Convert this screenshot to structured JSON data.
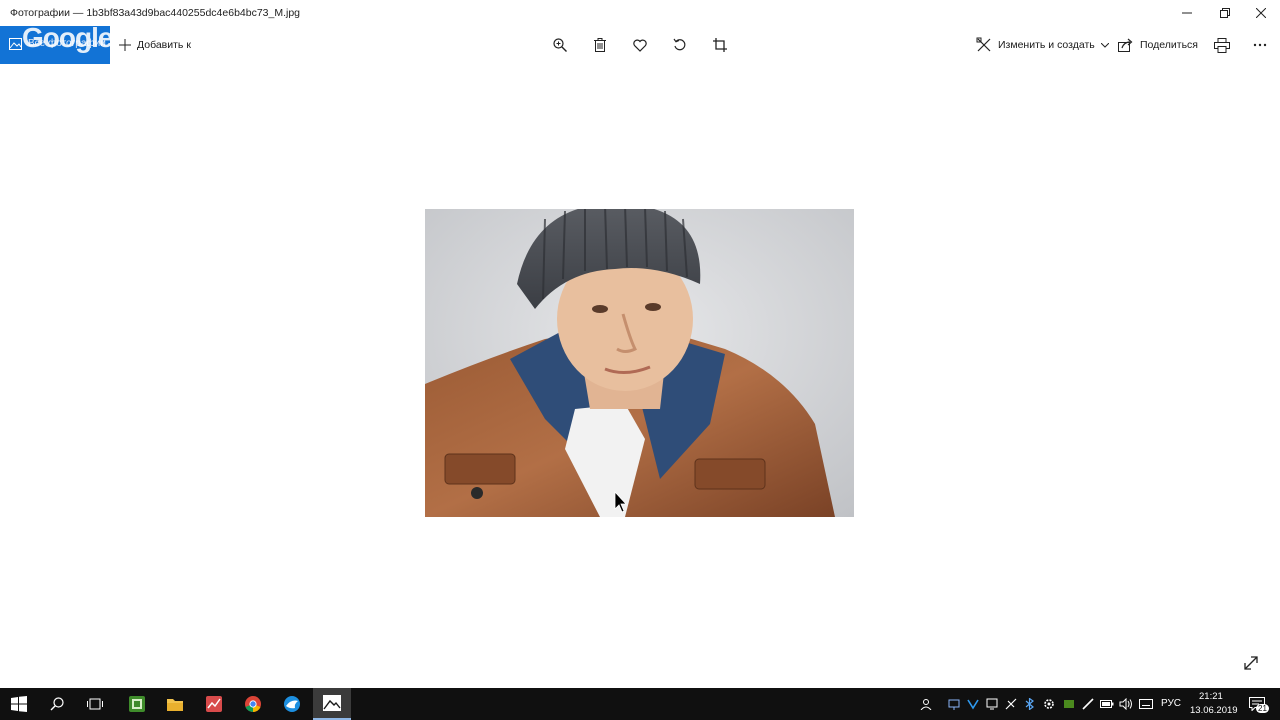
{
  "window": {
    "title": "Фотографии — 1b3bf83a43d9bac440255dc4e6b4bc73_M.jpg"
  },
  "toolbar": {
    "all_photos_label": "Все фотографии",
    "overlay_logo_text": "Google",
    "add_to_label": "Добавить к",
    "edit_create_label": "Изменить и создать",
    "share_label": "Поделиться",
    "icons": [
      "zoom-icon",
      "delete-icon",
      "favorite-icon",
      "rotate-icon",
      "crop-icon",
      "print-icon",
      "more-icon"
    ]
  },
  "taskbar": {
    "apps": [
      "start",
      "search",
      "task-view",
      "camtasia",
      "file-explorer",
      "app-red",
      "chrome",
      "mail",
      "photos"
    ],
    "language": "РУС",
    "time": "21:21",
    "date": "13.06.2019",
    "notification_count": "21"
  },
  "colors": {
    "accent": "#1273d6",
    "taskbar": "#101010"
  }
}
